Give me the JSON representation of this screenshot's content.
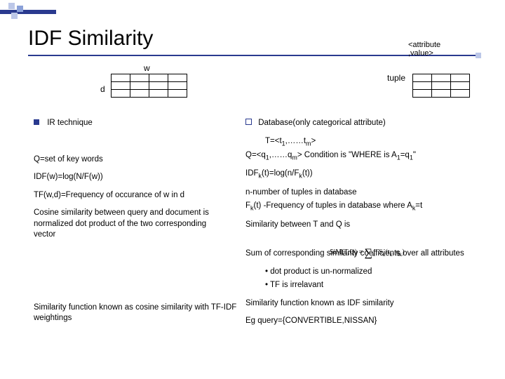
{
  "title": "IDF Similarity",
  "labels": {
    "w": "w",
    "d": "d",
    "attr_label": "<attribute\n,value>",
    "tuple": "tuple"
  },
  "left": {
    "ir_technique": "IR technique",
    "q_set": "Q=set of key words",
    "idf_w": "IDF(w)=log(N/F(w))",
    "tf": "TF(w,d)=Frequency of occurance of w in d",
    "cosine": "Cosine similarity between query and document is normalized dot product of the two corresponding vector",
    "similarity_fn": "Similarity function known as cosine similarity with TF-IDF weightings"
  },
  "right": {
    "db_attr": "Database(only categorical attribute)",
    "t_def": "T=<t1,……tm>",
    "q_def_prefix": "Q=<q",
    "q_def_mid1": ",……q",
    "q_def_suffix1": "> Condition is \"WHERE is A",
    "q_def_suffix2": "=q",
    "q_def_end": "\"",
    "idf_k": "IDFk(t)=log(n/Fk(t))",
    "n_def": "n-number of tuples in database",
    "fk_def_a": "F",
    "fk_def_b": "(t) -Frequency of tuples in database where A",
    "fk_def_c": "=t",
    "sim_tq": "Similarity between T and Q is",
    "sum_line": "Sum of corresponding similarity coefficients over all attributes",
    "dot_unnorm": "dot product is un-normalized",
    "tf_irr": "TF is irrelavant",
    "sim_fn_idf": "Similarity function known as IDF similarity",
    "eg": "Eg query={CONVERTIBLE,NISSAN}"
  },
  "formula": {
    "lhs": "SiM(T,Q) = ",
    "sum_sub": "k",
    "fn": "S",
    "args": "(t",
    "args2": ", q",
    "close": ")"
  }
}
